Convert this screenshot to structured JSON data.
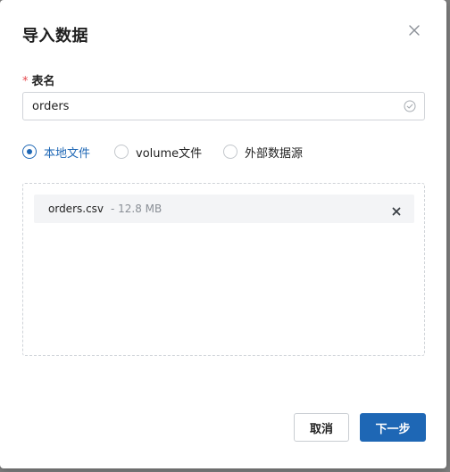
{
  "dialog": {
    "title": "导入数据",
    "close_icon": "close-icon"
  },
  "form": {
    "table_name": {
      "required_mark": "*",
      "label": "表名",
      "value": "orders",
      "status_icon": "check-circle-icon"
    },
    "source": {
      "options": [
        {
          "label": "本地文件",
          "checked": true
        },
        {
          "label": "volume文件",
          "checked": false
        },
        {
          "label": "外部数据源",
          "checked": false
        }
      ]
    },
    "upload": {
      "files": [
        {
          "name": "orders.csv",
          "size": "- 12.8 MB",
          "remove_icon": "remove-icon"
        }
      ]
    }
  },
  "footer": {
    "cancel_label": "取消",
    "next_label": "下一步"
  },
  "colors": {
    "primary": "#1e67b5",
    "required": "#e5484d",
    "muted_text": "#8a8f96"
  }
}
